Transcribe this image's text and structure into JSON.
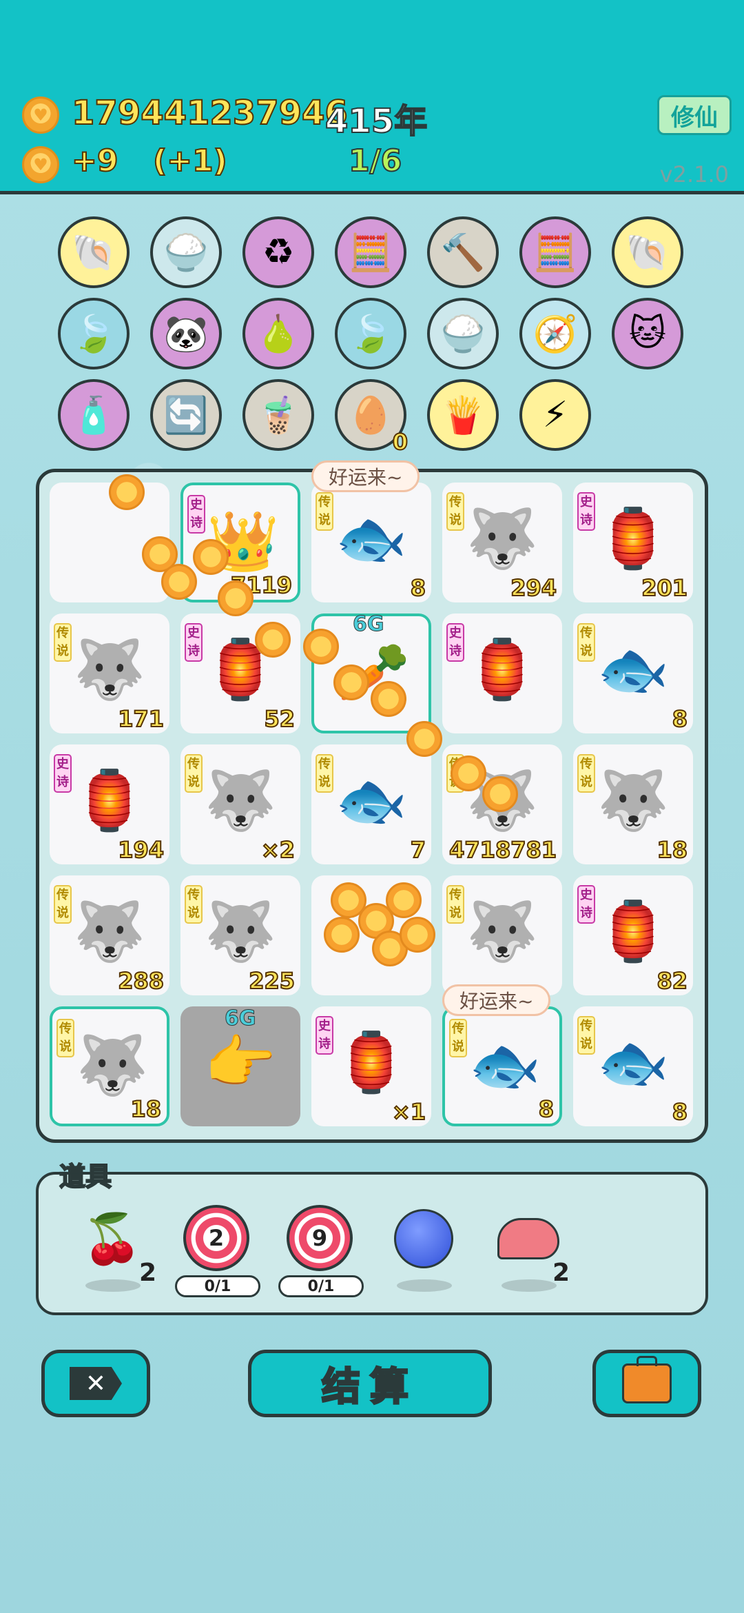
{
  "header": {
    "coins": "179441237946",
    "years": "415年",
    "income": "+9",
    "income_bonus": "(+1)",
    "progress": "1/6",
    "xiuxian_label": "修仙",
    "version": "v2.1.0"
  },
  "item_rows": [
    [
      "shell",
      "rice-bowl",
      "recycle",
      "math-head",
      "hammer",
      "math-head",
      "shell"
    ],
    [
      "leaf",
      "panda",
      "pomelo",
      "leaf",
      "rice-bowl",
      "compass",
      "cat"
    ],
    [
      "spray-bottle",
      "refresh",
      "milk-tea",
      "egg-tray",
      "fries",
      "lightning"
    ]
  ],
  "egg_tray_count": "0",
  "board": {
    "bubbles": [
      "好运来~",
      "好运来~"
    ],
    "g6_label": "6G",
    "cells": [
      {
        "tag": "",
        "value": "",
        "art": ""
      },
      {
        "tag": "史诗",
        "value": "7119",
        "art": "👑"
      },
      {
        "tag": "传说",
        "value": "8",
        "art": "🐟"
      },
      {
        "tag": "传说",
        "value": "294",
        "art": "🐺"
      },
      {
        "tag": "史诗",
        "value": "201",
        "art": "🏮"
      },
      {
        "tag": "传说",
        "value": "171",
        "art": "🐺"
      },
      {
        "tag": "史诗",
        "value": "52",
        "art": "🏮"
      },
      {
        "tag": "",
        "value": "",
        "art": "🥕"
      },
      {
        "tag": "史诗",
        "value": "",
        "art": "🏮"
      },
      {
        "tag": "传说",
        "value": "8",
        "art": "🐟"
      },
      {
        "tag": "史诗",
        "value": "194",
        "art": "🏮"
      },
      {
        "tag": "传说",
        "value": "×2",
        "art": "🐺"
      },
      {
        "tag": "传说",
        "value": "7",
        "art": "🐟"
      },
      {
        "tag": "传说",
        "value": "4718781",
        "art": "🐺"
      },
      {
        "tag": "传说",
        "value": "18",
        "art": "🐺"
      },
      {
        "tag": "传说",
        "value": "288",
        "art": "🐺"
      },
      {
        "tag": "传说",
        "value": "225",
        "art": "🐺"
      },
      {
        "tag": "",
        "value": "",
        "art": ""
      },
      {
        "tag": "传说",
        "value": "",
        "art": "🐺"
      },
      {
        "tag": "史诗",
        "value": "82",
        "art": "🏮"
      },
      {
        "tag": "传说",
        "value": "18",
        "art": "🐺"
      },
      {
        "tag": "",
        "value": "",
        "art": "👉"
      },
      {
        "tag": "史诗",
        "value": "×1",
        "art": "🏮"
      },
      {
        "tag": "传说",
        "value": "8",
        "art": "🐟"
      },
      {
        "tag": "传说",
        "value": "8",
        "art": "🐟"
      }
    ]
  },
  "props": {
    "title": "道具",
    "lychee_count": "2",
    "target1_num": "2",
    "target1_pill": "0/1",
    "target2_num": "9",
    "target2_pill": "0/1",
    "liver_count": "2"
  },
  "buttons": {
    "settle": "结算"
  }
}
